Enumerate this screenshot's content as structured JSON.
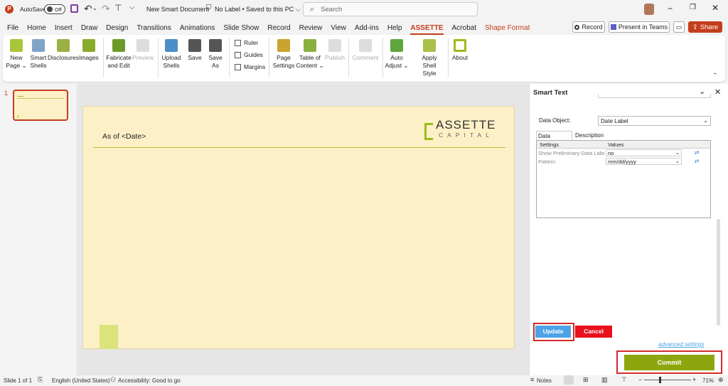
{
  "titlebar": {
    "autosave": "AutoSave",
    "toggle": "Off",
    "doc_title": "New Smart Document",
    "label_status": "No Label • Saved to this PC ⌵",
    "search_placeholder": "Search"
  },
  "tabs": [
    "File",
    "Home",
    "Insert",
    "Draw",
    "Design",
    "Transitions",
    "Animations",
    "Slide Show",
    "Record",
    "Review",
    "View",
    "Add-ins",
    "Help",
    "ASSETTE",
    "Acrobat",
    "Shape Format"
  ],
  "active_tab": "ASSETTE",
  "actions": {
    "record": "Record",
    "present": "Present in Teams",
    "share": "Share"
  },
  "ribbon": {
    "new_page": "New Page ⌄",
    "smart_shells": "Smart Shells",
    "disclosures": "Disclosures",
    "images": "Images",
    "fabricate": "Fabricate and Edit",
    "preview": "Preview",
    "upload_shells": "Upload Shells",
    "save": "Save",
    "save_as": "Save As",
    "ruler": "Ruler",
    "guides": "Guides",
    "margins": "Margins",
    "page_settings": "Page Settings",
    "toc": "Table of Content ⌄",
    "publish": "Publish",
    "comment": "Comment",
    "auto_adjust": "Auto Adjust ⌄",
    "apply_shell_style": "Apply Shell Style",
    "about": "About"
  },
  "thumb_number": "1",
  "slide": {
    "date_text": "As of <Date>",
    "logo_top": "ASSETTE",
    "logo_bottom": "CAPITAL"
  },
  "pane": {
    "title": "Smart Text",
    "data_object_label": "Data Object:",
    "data_object_value": "Date Label",
    "tab_settings": "Data Settings",
    "tab_description": "Description",
    "col_settings": "Settings",
    "col_values": "Values",
    "rows": [
      {
        "setting": "Show Preliminary Data Labe",
        "value": "no"
      },
      {
        "setting": "Pattern",
        "value": "mm/dd/yyyy"
      }
    ],
    "update": "Update",
    "cancel": "Cancel",
    "advanced": "advanced settings",
    "commit": "Commit"
  },
  "status": {
    "slide": "Slide 1 of 1",
    "language": "English (United States)",
    "accessibility": "Accessibility: Good to go",
    "notes": "Notes",
    "zoom": "71%"
  },
  "colors": {
    "accent": "#c43e1c",
    "update_blue": "#4da3e8",
    "cancel_red": "#e8101c",
    "commit_green": "#8ea60e",
    "slide_bg": "#fdf0c6",
    "logo_green": "#9bbb1e"
  }
}
